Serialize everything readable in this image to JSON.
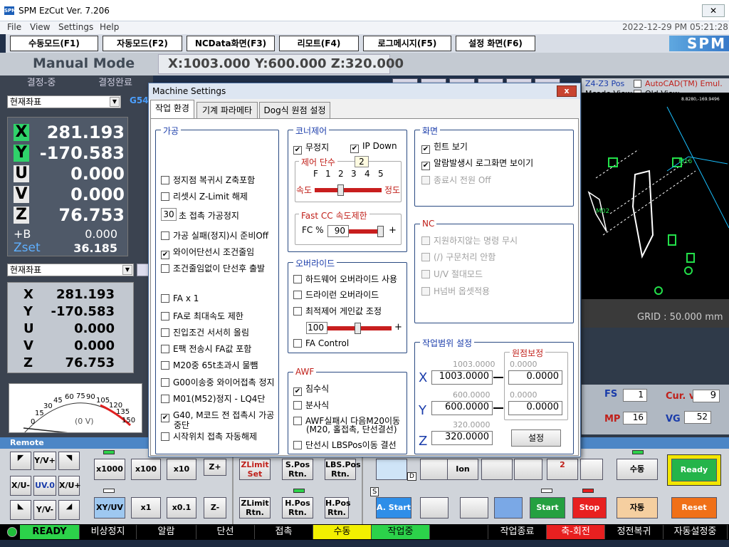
{
  "app": {
    "title": "SPM EzCut Ver. 7.206",
    "logo_text": "SPM",
    "datetime": "2022-12-29 PM 05:21:28",
    "brand_logo": "SPM"
  },
  "menu": [
    "File",
    "View",
    "Settings",
    "Help"
  ],
  "top_tabs": [
    "수동모드(F1)",
    "자동모드(F2)",
    "NCData화면(F3)",
    "리모트(F4)",
    "로그메시지(F5)",
    "설정 화면(F6)"
  ],
  "mode_title": "Manual Mode",
  "machine_coords": "X:1003.000 Y:600.000 Z:320.000",
  "left": {
    "hdr1": "결정-중",
    "hdr2": "결정완료",
    "coord_select": "현재좌표",
    "g_code": "G54",
    "axes": [
      {
        "l": "X",
        "v": "281.193"
      },
      {
        "l": "Y",
        "v": "-170.583"
      },
      {
        "l": "U",
        "v": "0.000"
      },
      {
        "l": "V",
        "v": "0.000"
      },
      {
        "l": "Z",
        "v": "76.753"
      }
    ],
    "b_label": "+B",
    "b_value": "0.000",
    "zset_label": "Zset",
    "zset_value": "36.185",
    "coord_select2": "현재좌표",
    "axes2": [
      {
        "l": "X",
        "v": "281.193"
      },
      {
        "l": "Y",
        "v": "-170.583"
      },
      {
        "l": "U",
        "v": "0.000"
      },
      {
        "l": "V",
        "v": "0.000"
      },
      {
        "l": "Z",
        "v": "76.753"
      }
    ],
    "gauge_ticks": [
      "0",
      "15",
      "30",
      "45",
      "60",
      "75",
      "90",
      "105",
      "120",
      "135",
      "150"
    ],
    "gauge_value": "(0 V)"
  },
  "right": {
    "z4z3": "Z4-Z3 Pos",
    "autocad": "AutoCAD(TM) Emul.",
    "mcode_view": "Mcode View",
    "old_view": "Old View",
    "coords_small": "8.8280,-169.9496",
    "grid": "GRID : 50.000 mm",
    "m_labels": [
      "M16",
      "M02"
    ],
    "fs_label": "FS",
    "fs_value": "1",
    "curv_label": "Cur. v",
    "curv_value": "9",
    "mp_label": "MP",
    "mp_value": "16",
    "vg_label": "VG",
    "vg_value": "52"
  },
  "dialog": {
    "title": "Machine Settings",
    "close": "x",
    "tabs": [
      "작업 환경",
      "기계 파라메타",
      "Dog식 원점 설정"
    ],
    "process": {
      "title": "가공",
      "items": [
        {
          "t": "정지점 복귀시 Z축포함",
          "c": false
        },
        {
          "t": "리셋시 Z-Limit 해제",
          "c": false
        },
        {
          "t": "초 접촉 가공정지",
          "c": false,
          "val": "30"
        },
        {
          "t": "가공 실패(정지)시 준비Off",
          "c": false
        },
        {
          "t": "와이어단선시 조건줄임",
          "c": true
        },
        {
          "t": "조건줄임없이 단선후 출발",
          "c": false
        },
        {
          "t": "FA x 1",
          "c": false
        },
        {
          "t": "FA로 최대속도 제한",
          "c": false
        },
        {
          "t": "진입조건 서서히 올림",
          "c": false
        },
        {
          "t": "E팩 전송시 FA값 포함",
          "c": false
        },
        {
          "t": "M20중 65t초과시 물뺌",
          "c": false
        },
        {
          "t": "G00이송중 와이어접촉 정지",
          "c": false
        },
        {
          "t": "M01(M52)정지 - LQ4단",
          "c": false
        },
        {
          "t": "G40, M코드 전 접촉시 가공",
          "t2": "중단",
          "c": true
        },
        {
          "t": "시작위치 접촉 자동해제",
          "c": false
        }
      ]
    },
    "corner": {
      "title": "코너제어",
      "nostop": "무정지",
      "ipdown": "IP Down",
      "nostop_c": true,
      "ipdown_c": true,
      "stage_title": "제어 단수",
      "stage_value": "2",
      "ticks": [
        "F",
        "1",
        "2",
        "3",
        "4",
        "5"
      ],
      "speed": "속도",
      "accuracy": "정도",
      "fastcc_title": "Fast CC 속도제한",
      "fc_label": "FC %",
      "fc_value": "90",
      "plus": "+"
    },
    "override": {
      "title": "오버라이드",
      "items": [
        {
          "t": "하드웨어 오버라이드 사용",
          "c": false
        },
        {
          "t": "드라이런 오버라이드",
          "c": false
        },
        {
          "t": "최적제어 게인값 조정",
          "c": false
        }
      ],
      "gain": "100",
      "plus": "+",
      "facontrol": "FA Control"
    },
    "awf": {
      "title": "AWF",
      "items": [
        {
          "t": "침수식",
          "c": true
        },
        {
          "t": "분사식",
          "c": false
        },
        {
          "t": "AWF실패시 다음M20이동",
          "t2": "(M20, 홀접촉, 단선결선)",
          "c": false
        },
        {
          "t": "단선시 LBSPos이동 결선",
          "c": false
        }
      ]
    },
    "screen": {
      "title": "화면",
      "items": [
        {
          "t": "힌트 보기",
          "c": true,
          "d": false
        },
        {
          "t": "알람발생시 로그화면 보이기",
          "c": true,
          "d": false
        },
        {
          "t": "종료시 전원 Off",
          "c": false,
          "d": true
        }
      ]
    },
    "nc": {
      "title": "NC",
      "items": [
        "지원하지않는 명령 무시",
        "(/) 구문처리 안함",
        "U/V 절대모드",
        "H넘버 옵셋적용"
      ]
    },
    "range": {
      "title": "작업범위 설정",
      "origin_title": "원점보정",
      "set": "설정",
      "axes": [
        {
          "l": "X",
          "lim": "1003.0000",
          "v": "1003.0000",
          "olim": "0.0000",
          "ov": "0.0000"
        },
        {
          "l": "Y",
          "lim": "600.0000",
          "v": "600.0000",
          "olim": "0.0000",
          "ov": "0.0000"
        },
        {
          "l": "Z",
          "lim": "320.0000",
          "v": "320.0000"
        }
      ]
    }
  },
  "remote": {
    "title": "Remote",
    "jog": [
      "Y/V+",
      "X/U-",
      "UV.0",
      "X/U+",
      "Y/V-"
    ],
    "step": [
      "x1000",
      "x100",
      "x10",
      "x1",
      "x0.1",
      "XY/UV"
    ],
    "zplus": "Z+",
    "zminus": "Z-",
    "fn1": [
      "ZLimit Set",
      "S.Pos Rtn.",
      "LBS.Pos Rtn."
    ],
    "fn2": [
      "ZLimit Rtn.",
      "H.Pos Rtn.",
      "H.Pos Rtn."
    ],
    "astart": "A. Start",
    "start": "Start",
    "stop": "Stop",
    "manual": "수동",
    "auto": "자동",
    "ready": "Ready",
    "reset": "Reset",
    "ion": "Ion",
    "pump_badge": "2",
    "d_badge": "D",
    "s_badge": "S"
  },
  "status": [
    "READY",
    "비상정지",
    "알람",
    "단선",
    "접촉",
    "수동",
    "작업중",
    "",
    "작업종료",
    "축-회전",
    "정전복귀",
    "자동설정중"
  ],
  "colors": {
    "status_ready": "#2cd24a",
    "status_manual": "#f2f000",
    "status_working": "#2cd24a",
    "status_axis": "#e82020",
    "ready_btn": "#24b44a",
    "reset_btn": "#f07018",
    "stop_btn": "#e82020",
    "start_btn": "#24a040",
    "auto_btn": "#f5cfa0",
    "astart_btn": "#2e8ee8"
  }
}
